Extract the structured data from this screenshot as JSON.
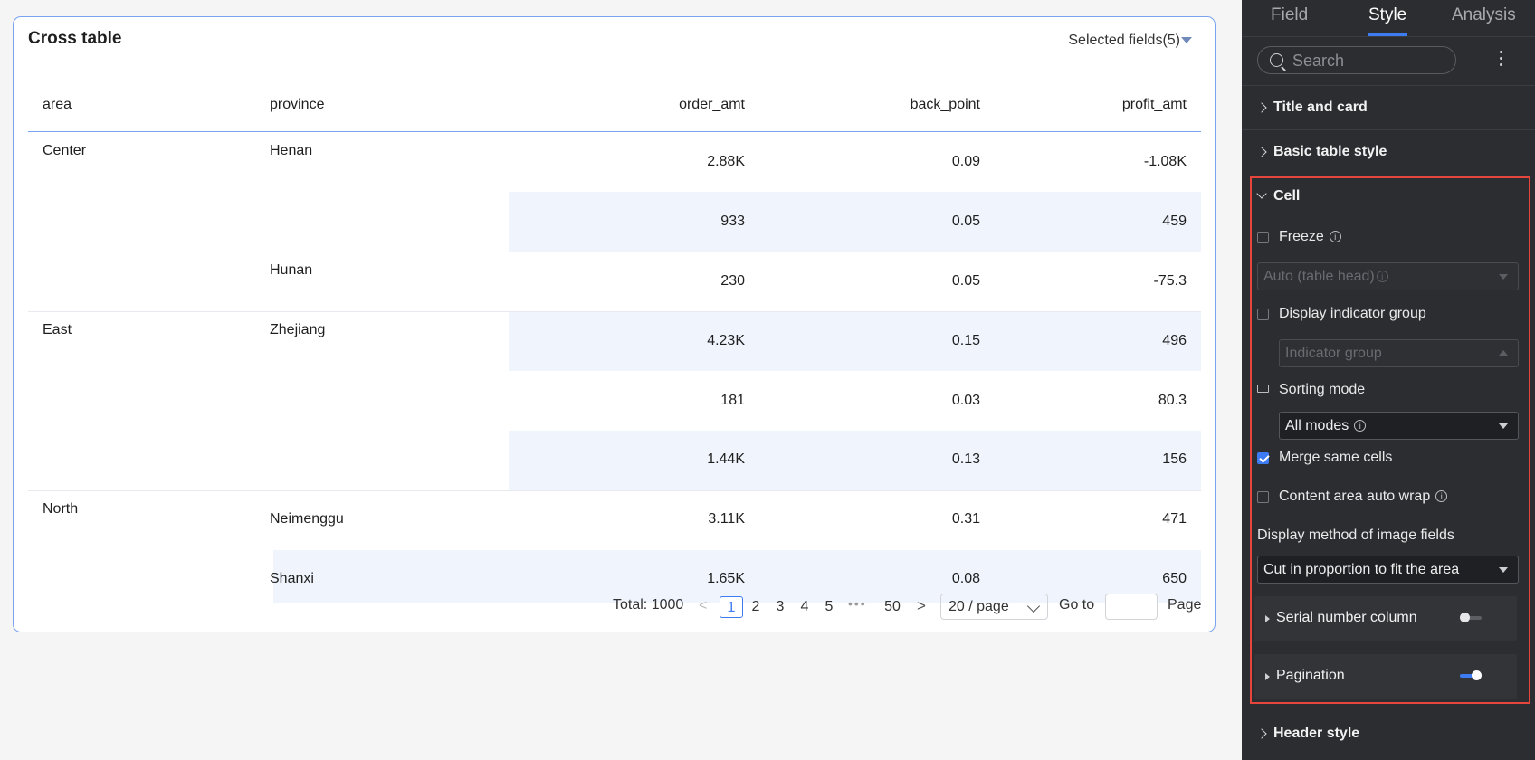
{
  "card": {
    "title": "Cross table",
    "selected_fields": "Selected fields(5)"
  },
  "table": {
    "columns": [
      "area",
      "province",
      "order_amt",
      "back_point",
      "profit_amt"
    ],
    "rows": [
      {
        "area": "Center",
        "province": "Henan",
        "order_amt": "2.88K",
        "back_point": "0.09",
        "profit_amt": "-1.08K"
      },
      {
        "area": "",
        "province": "",
        "order_amt": "933",
        "back_point": "0.05",
        "profit_amt": "459"
      },
      {
        "area": "",
        "province": "Hunan",
        "order_amt": "230",
        "back_point": "0.05",
        "profit_amt": "-75.3"
      },
      {
        "area": "East",
        "province": "Zhejiang",
        "order_amt": "4.23K",
        "back_point": "0.15",
        "profit_amt": "496"
      },
      {
        "area": "",
        "province": "",
        "order_amt": "181",
        "back_point": "0.03",
        "profit_amt": "80.3"
      },
      {
        "area": "",
        "province": "",
        "order_amt": "1.44K",
        "back_point": "0.13",
        "profit_amt": "156"
      },
      {
        "area": "North",
        "province": "Neimenggu",
        "order_amt": "3.11K",
        "back_point": "0.31",
        "profit_amt": "471"
      },
      {
        "area": "",
        "province": "Shanxi",
        "order_amt": "1.65K",
        "back_point": "0.08",
        "profit_amt": "650"
      }
    ]
  },
  "pagination": {
    "total": "Total: 1000",
    "pages": [
      "1",
      "2",
      "3",
      "4",
      "5"
    ],
    "ellipsis": "•••",
    "last": "50",
    "current": "1",
    "page_size": "20 / page",
    "goto_label": "Go to",
    "page_label": "Page"
  },
  "panel": {
    "tabs": [
      "Field",
      "Style",
      "Analysis"
    ],
    "active_tab": "Style",
    "search_placeholder": "Search",
    "sections": {
      "title_and_card": "Title and card",
      "basic_table_style": "Basic table style",
      "cell": "Cell",
      "header_style": "Header style"
    },
    "cell": {
      "freeze": {
        "label": "Freeze",
        "checked": false
      },
      "freeze_select": "Auto (table head)",
      "display_indicator_group": {
        "label": "Display indicator group",
        "checked": false
      },
      "indicator_group_select": "Indicator group",
      "sorting_mode_label": "Sorting mode",
      "sorting_mode_select": "All modes",
      "merge_same_cells": {
        "label": "Merge same cells",
        "checked": true
      },
      "content_area_auto_wrap": {
        "label": "Content area auto wrap",
        "checked": false
      },
      "image_display_label": "Display method of image fields",
      "image_display_select": "Cut in proportion to fit the area",
      "serial_number_column": {
        "label": "Serial number column",
        "enabled": false
      },
      "pagination": {
        "label": "Pagination",
        "enabled": true
      }
    }
  },
  "colors": {
    "accent": "#3d7bf2",
    "row_band": "#f0f5fd",
    "panel_bg": "#2c2d31",
    "highlight_box": "#e6453c"
  }
}
